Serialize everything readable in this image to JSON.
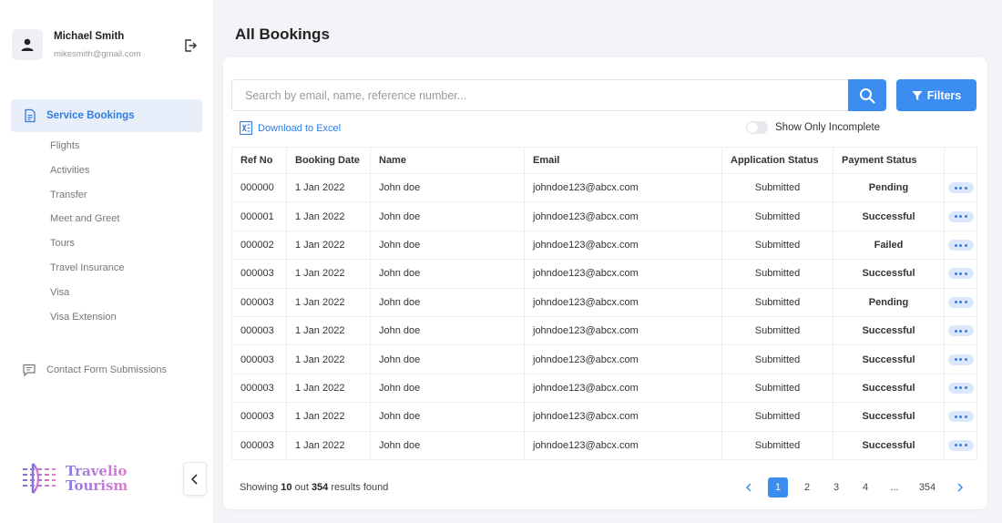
{
  "user": {
    "name": "Michael Smith",
    "email": "mikesmith@gmail.com"
  },
  "sidebar": {
    "active_label": "Service Bookings",
    "sub_items": [
      "Flights",
      "Activities",
      "Transfer",
      "Meet and Greet",
      "Tours",
      "Travel Insurance",
      "Visa",
      "Visa Extension"
    ],
    "contact_label": "Contact Form Submissions"
  },
  "brand": {
    "line1": "Travelio",
    "line2": "Tourism"
  },
  "page": {
    "title": "All Bookings"
  },
  "search": {
    "placeholder": "Search by email, name, reference number...",
    "value": ""
  },
  "toolbar": {
    "filters_label": "Filters",
    "download_label": "Download to Excel",
    "toggle_label": "Show Only Incomplete",
    "toggle_on": false
  },
  "table": {
    "headers": [
      "Ref No",
      "Booking Date",
      "Name",
      "Email",
      "Application Status",
      "Payment Status",
      ""
    ],
    "rows": [
      {
        "ref": "000000",
        "date": "1 Jan 2022",
        "name": "John doe",
        "email": "johndoe123@abcx.com",
        "app": "Submitted",
        "pay": "Pending"
      },
      {
        "ref": "000001",
        "date": "1 Jan 2022",
        "name": "John doe",
        "email": "johndoe123@abcx.com",
        "app": "Submitted",
        "pay": "Successful"
      },
      {
        "ref": "000002",
        "date": "1 Jan 2022",
        "name": "John doe",
        "email": "johndoe123@abcx.com",
        "app": "Submitted",
        "pay": "Failed"
      },
      {
        "ref": "000003",
        "date": "1 Jan 2022",
        "name": "John doe",
        "email": "johndoe123@abcx.com",
        "app": "Submitted",
        "pay": "Successful"
      },
      {
        "ref": "000003",
        "date": "1 Jan 2022",
        "name": "John doe",
        "email": "johndoe123@abcx.com",
        "app": "Submitted",
        "pay": "Pending"
      },
      {
        "ref": "000003",
        "date": "1 Jan 2022",
        "name": "John doe",
        "email": "johndoe123@abcx.com",
        "app": "Submitted",
        "pay": "Successful"
      },
      {
        "ref": "000003",
        "date": "1 Jan 2022",
        "name": "John doe",
        "email": "johndoe123@abcx.com",
        "app": "Submitted",
        "pay": "Successful"
      },
      {
        "ref": "000003",
        "date": "1 Jan 2022",
        "name": "John doe",
        "email": "johndoe123@abcx.com",
        "app": "Submitted",
        "pay": "Successful"
      },
      {
        "ref": "000003",
        "date": "1 Jan 2022",
        "name": "John doe",
        "email": "johndoe123@abcx.com",
        "app": "Submitted",
        "pay": "Successful"
      },
      {
        "ref": "000003",
        "date": "1 Jan 2022",
        "name": "John doe",
        "email": "johndoe123@abcx.com",
        "app": "Submitted",
        "pay": "Successful"
      }
    ]
  },
  "footer": {
    "showing_prefix": "Showing",
    "shown_count": "10",
    "out_label": "out",
    "total": "354",
    "suffix": "results found"
  },
  "pagination": {
    "pages": [
      "1",
      "2",
      "3",
      "4",
      "...",
      "354"
    ],
    "current": "1"
  },
  "colors": {
    "accent": "#3b8ef0",
    "pending": "#f0795a",
    "successful": "#4fce6a",
    "failed": "#ee4747"
  }
}
